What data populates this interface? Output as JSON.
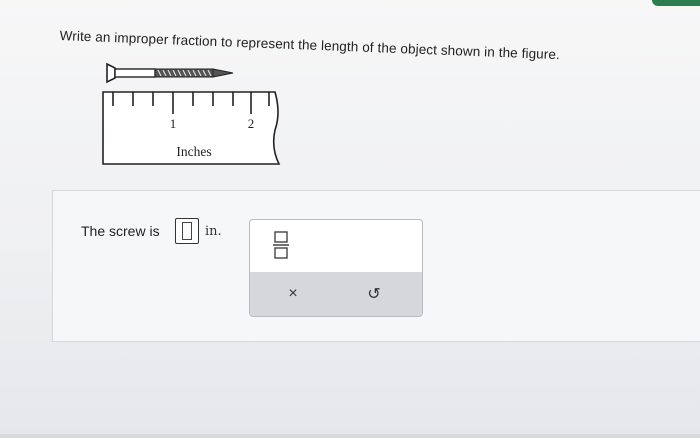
{
  "question": {
    "text": "Write an improper fraction to represent the length of the object shown in the figure."
  },
  "figure": {
    "ruler_labels": [
      "1",
      "2"
    ],
    "ruler_unit_label": "Inches"
  },
  "answer": {
    "prompt": "The screw is",
    "value": "",
    "unit": "in."
  },
  "palette": {
    "fraction_icon": "fraction-template-icon",
    "clear_icon": "×",
    "undo_icon": "↺"
  },
  "colors": {
    "accent_bar": "#2f7d4f",
    "panel_border": "#d5d7da"
  }
}
